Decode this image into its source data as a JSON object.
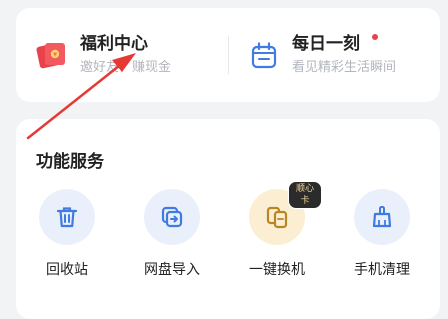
{
  "promos": [
    {
      "title": "福利中心",
      "subtitle": "邀好友，赚现金",
      "icon": "red-envelope-icon"
    },
    {
      "title": "每日一刻",
      "subtitle": "看见精彩生活瞬间",
      "icon": "calendar-icon"
    }
  ],
  "services": {
    "title": "功能服务",
    "items": [
      {
        "label": "回收站",
        "icon": "trash-icon"
      },
      {
        "label": "网盘导入",
        "icon": "import-icon"
      },
      {
        "label": "一键换机",
        "icon": "phone-switch-icon",
        "badge": "顺心卡"
      },
      {
        "label": "手机清理",
        "icon": "brush-icon"
      }
    ]
  },
  "colors": {
    "accent": "#3f7be0",
    "badge_bg": "#2b2b2b",
    "dot": "#e8434b",
    "annotation": "#e53935"
  }
}
